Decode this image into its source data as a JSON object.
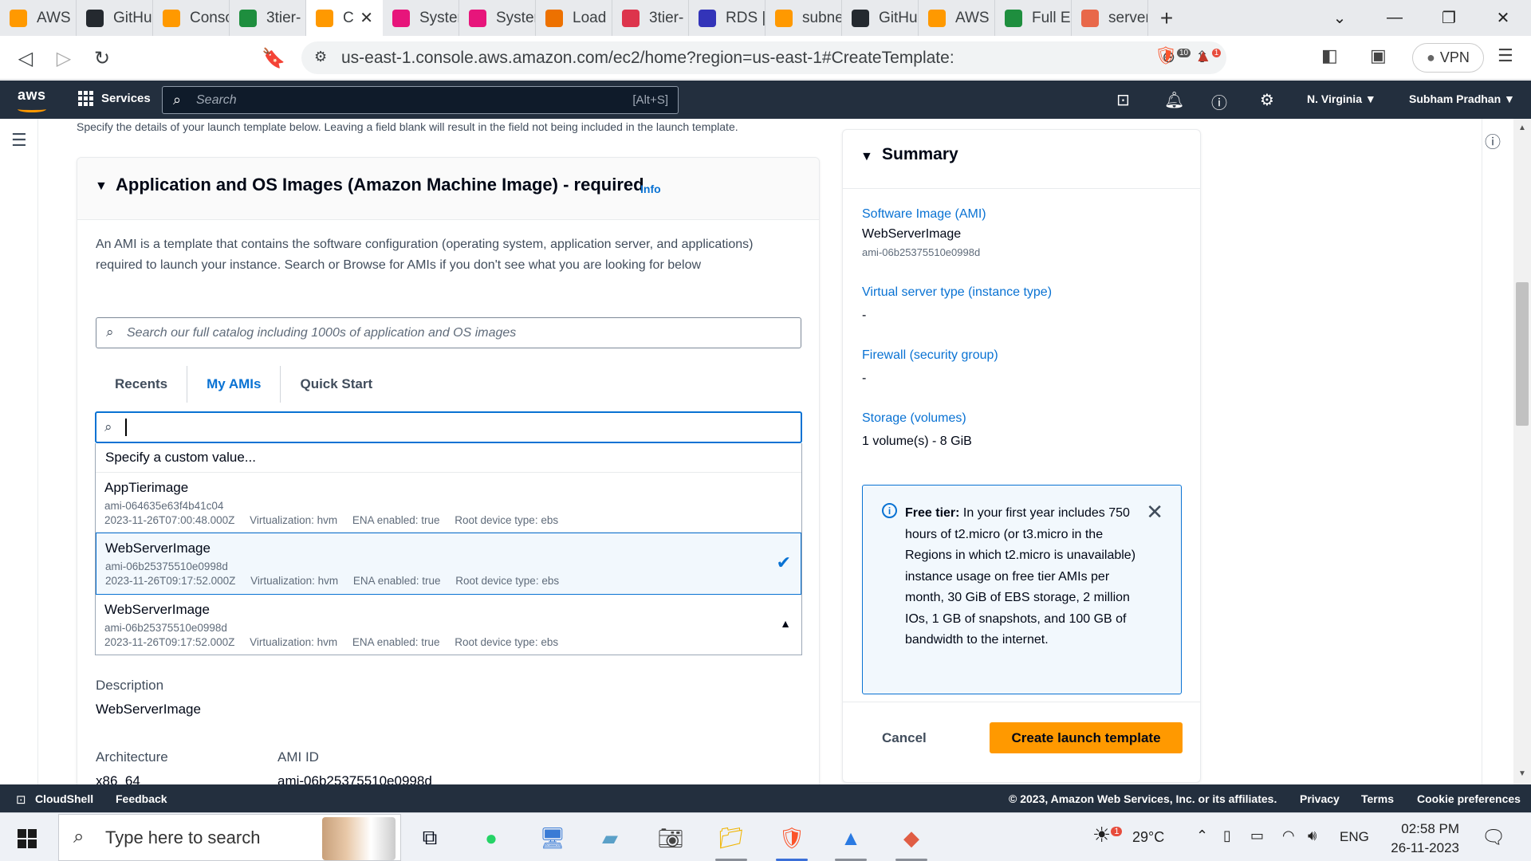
{
  "browser": {
    "tabs": [
      {
        "label": "AWS",
        "color": "#ff9900"
      },
      {
        "label": "GitHu",
        "color": "#24292f"
      },
      {
        "label": "Consc",
        "color": "#ff9900"
      },
      {
        "label": "3tier-",
        "color": "#1e8e3e"
      },
      {
        "label": "C",
        "color": "#ff9900",
        "active": true
      },
      {
        "label": "Syster",
        "color": "#e7157b"
      },
      {
        "label": "Syster",
        "color": "#e7157b"
      },
      {
        "label": "Load",
        "color": "#ed7100"
      },
      {
        "label": "3tier-",
        "color": "#dd344c"
      },
      {
        "label": "RDS |",
        "color": "#3334b9"
      },
      {
        "label": "subne",
        "color": "#ff9900"
      },
      {
        "label": "GitHu",
        "color": "#24292f"
      },
      {
        "label": "AWS",
        "color": "#ff9900"
      },
      {
        "label": "Full E",
        "color": "#1e8e3e"
      },
      {
        "label": "server",
        "color": "#e8684a"
      }
    ],
    "url": "us-east-1.console.aws.amazon.com/ec2/home?region=us-east-1#CreateTemplate:",
    "vpn_label": "VPN",
    "shield_count": "10",
    "alert_count": "1"
  },
  "aws_nav": {
    "logo": "aws",
    "services": "Services",
    "search_placeholder": "Search",
    "search_shortcut": "[Alt+S]",
    "region": "N. Virginia ▼",
    "user": "Subham Pradhan ▼"
  },
  "page": {
    "intro": "Specify the details of your launch template below. Leaving a field blank will result in the field not being included in the launch template."
  },
  "ami": {
    "title": "Application and OS Images (Amazon Machine Image) - required",
    "info": "Info",
    "description": "An AMI is a template that contains the software configuration (operating system, application server, and applications) required to launch your instance. Search or Browse for AMIs if you don't see what you are looking for below",
    "catalog_placeholder": "Search our full catalog including 1000s of application and OS images",
    "tabs": [
      "Recents",
      "My AMIs",
      "Quick Start"
    ],
    "selected_tab": "My AMIs",
    "combo_value": "",
    "custom_option": "Specify a custom value...",
    "options": [
      {
        "name": "AppTierimage",
        "id": "ami-064635e63f4b41c04",
        "meta": "2023-11-26T07:00:48.000Z     Virtualization: hvm     ENA enabled: true     Root device type: ebs"
      },
      {
        "name": "WebServerImage",
        "id": "ami-06b25375510e0998d",
        "meta": "2023-11-26T09:17:52.000Z     Virtualization: hvm     ENA enabled: true     Root device type: ebs",
        "selected": true
      },
      {
        "name": "WebServerImage",
        "id": "ami-06b25375510e0998d",
        "meta": "2023-11-26T09:17:52.000Z     Virtualization: hvm     ENA enabled: true     Root device type: ebs"
      }
    ],
    "description_label": "Description",
    "description_value": "WebServerImage",
    "architecture_label": "Architecture",
    "architecture_value": "x86_64",
    "ami_id_label": "AMI ID",
    "ami_id_value": "ami-06b25375510e0998d"
  },
  "summary": {
    "title": "Summary",
    "software_image_label": "Software Image (AMI)",
    "software_image_value": "WebServerImage",
    "software_image_id": "ami-06b25375510e0998d",
    "instance_type_label": "Virtual server type (instance type)",
    "instance_type_value": "-",
    "firewall_label": "Firewall (security group)",
    "firewall_value": "-",
    "storage_label": "Storage (volumes)",
    "storage_value": "1 volume(s) - 8 GiB",
    "free_tier_title": "Free tier:",
    "free_tier_text": " In your first year includes 750 hours of t2.micro (or t3.micro in the Regions in which t2.micro is unavailable) instance usage on free tier AMIs per month, 30 GiB of EBS storage, 2 million IOs, 1 GB of snapshots, and 100 GB of bandwidth to the internet.",
    "cancel": "Cancel",
    "create": "Create launch template"
  },
  "footer": {
    "cloudshell": "CloudShell",
    "feedback": "Feedback",
    "copyright": "© 2023, Amazon Web Services, Inc. or its affiliates.",
    "privacy": "Privacy",
    "terms": "Terms",
    "cookies": "Cookie preferences"
  },
  "taskbar": {
    "search_placeholder": "Type here to search",
    "weather": "29°C",
    "weather_badge": "1",
    "language": "ENG",
    "time": "02:58 PM",
    "date": "26-11-2023"
  },
  "colors": {
    "aws_nav": "#232f3e",
    "link": "#0972d3",
    "primary_button": "#ff9900"
  }
}
